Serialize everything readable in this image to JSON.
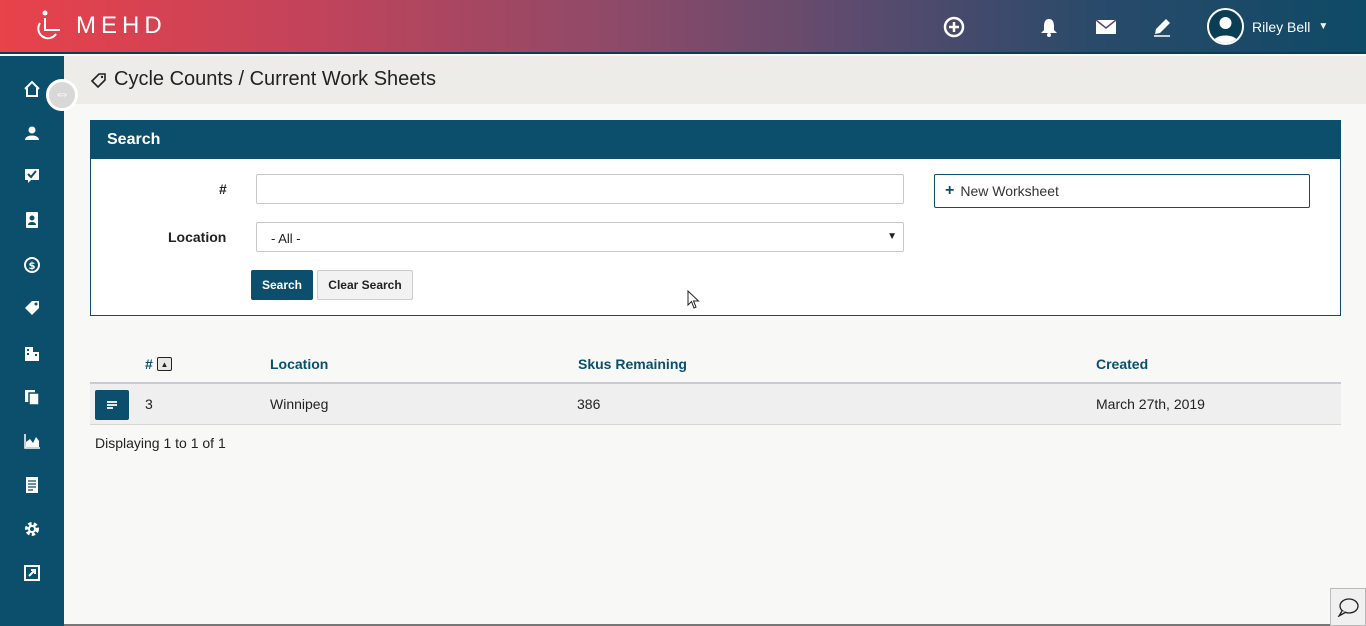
{
  "brand": {
    "name": "MEHD"
  },
  "topbar": {
    "icons": [
      "add-circle-icon",
      "bell-icon",
      "mail-icon",
      "pencil-icon"
    ],
    "user": {
      "name": "Riley Bell"
    }
  },
  "sidebar": {
    "items": [
      "home-icon",
      "users-icon",
      "checklist-icon",
      "contacts-icon",
      "dollar-icon",
      "tag-icon",
      "buildings-icon",
      "documents-icon",
      "chart-icon",
      "report-icon",
      "gear-icon",
      "external-link-icon"
    ]
  },
  "page": {
    "title": "Cycle Counts / Current Work Sheets"
  },
  "search": {
    "title": "Search",
    "number_label": "#",
    "number_value": "",
    "location_label": "Location",
    "location_selected": "- All -",
    "new_worksheet_label": "New Worksheet",
    "search_button": "Search",
    "clear_button": "Clear Search"
  },
  "table": {
    "columns": [
      "#",
      "Location",
      "Skus Remaining",
      "Created"
    ],
    "rows": [
      {
        "number": "3",
        "location": "Winnipeg",
        "skus_remaining": "386",
        "created": "March 27th, 2019"
      }
    ],
    "footer": "Displaying 1 to 1 of 1"
  },
  "colors": {
    "primary": "#0b4f6c",
    "gradient_start": "#e8424a",
    "gradient_end": "#0e4a66"
  }
}
